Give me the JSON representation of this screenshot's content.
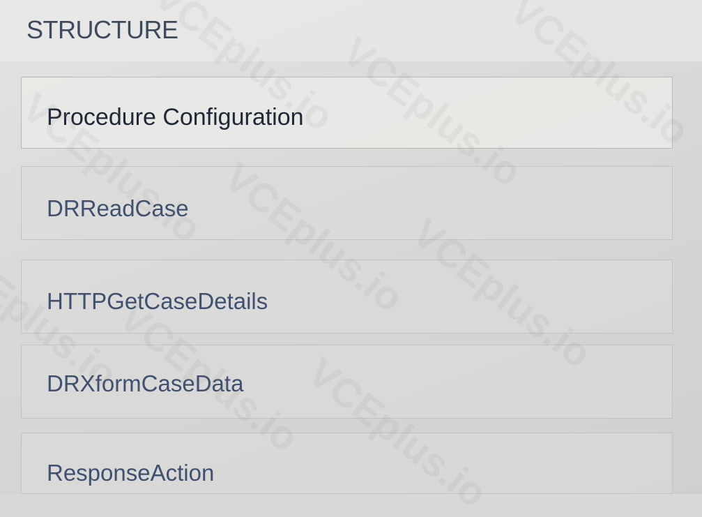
{
  "section": {
    "title": "STRUCTURE"
  },
  "structure": {
    "items": [
      {
        "label": "Procedure Configuration"
      },
      {
        "label": "DRReadCase"
      },
      {
        "label": "HTTPGetCaseDetails"
      },
      {
        "label": "DRXformCaseData"
      },
      {
        "label": "ResponseAction"
      }
    ]
  },
  "watermark": {
    "text": "VCEplus.io"
  },
  "colors": {
    "background": "#d9d8d6",
    "title_text": "#3e4a5e",
    "item_text": "#3f5070",
    "selected_item_text": "#202838"
  }
}
